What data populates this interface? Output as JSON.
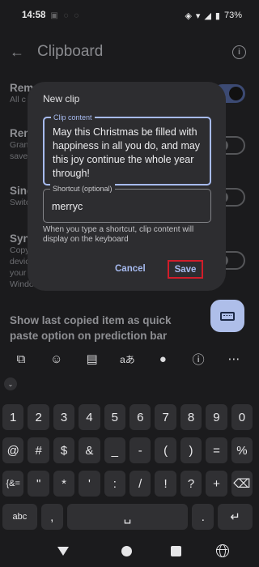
{
  "status_bar": {
    "time": "14:58",
    "battery": "73%"
  },
  "app_bar": {
    "title": "Clipboard"
  },
  "background_settings": [
    {
      "title": "Rem",
      "subtitle": "All c"
    },
    {
      "title": "Rem",
      "subtitle_lines": [
        "Gran",
        "save"
      ]
    },
    {
      "title": "Sing",
      "subtitle": "Switc"
    },
    {
      "title": "Sync",
      "subtitle_lines": [
        "Copy",
        "devic",
        "your",
        "Windo"
      ]
    },
    {
      "title": "Show last copied item as quick paste option on prediction bar"
    }
  ],
  "dialog": {
    "title": "New clip",
    "clip_content_label": "Clip content",
    "clip_content_value": "May this Christmas be filled with happiness in all you do, and may this joy continue the whole year through!",
    "shortcut_label": "Shortcut (optional)",
    "shortcut_value": "merryc",
    "helper_text": "When you type a shortcut, clip content will display on the keyboard",
    "cancel_label": "Cancel",
    "save_label": "Save"
  },
  "keyboard": {
    "toolbar_icons": [
      "copilot-icon",
      "emoji-sticker-icon",
      "clipboard-icon",
      "translate-icon",
      "microphone-icon",
      "info-icon",
      "more-icon"
    ],
    "rows": [
      [
        "1",
        "2",
        "3",
        "4",
        "5",
        "6",
        "7",
        "8",
        "9",
        "0"
      ],
      [
        "@",
        "#",
        "$",
        "&",
        "_",
        "-",
        "(",
        ")",
        "=",
        "%"
      ],
      [
        "{&=",
        "\"",
        "*",
        "'",
        ":",
        "/",
        "!",
        "?",
        "+",
        "⌫"
      ],
      [
        "abc",
        ",",
        "␣",
        ".",
        "↵"
      ]
    ]
  },
  "colors": {
    "accent": "#a7bbf0",
    "save_highlight": "#d11d2a",
    "dialog_bg": "#2d2d30",
    "background": "#1b1b1d"
  }
}
